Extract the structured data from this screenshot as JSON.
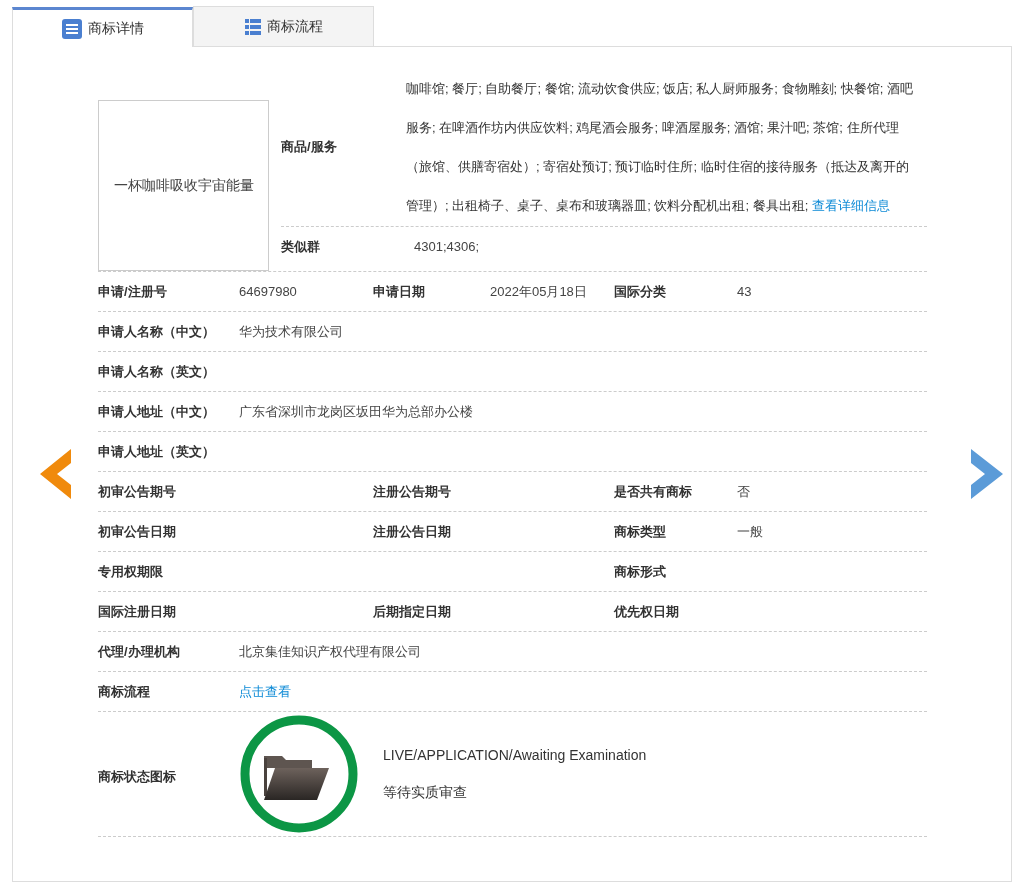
{
  "tabs": [
    {
      "label": "商标详情",
      "kind": "details",
      "selected": true
    },
    {
      "label": "商标流程",
      "kind": "flow",
      "selected": false
    }
  ],
  "trademark": {
    "image_text": "一杯咖啡吸收宇宙能量",
    "goods_label": "商品/服务",
    "goods_text": "咖啡馆; 餐厅; 自助餐厅; 餐馆; 流动饮食供应; 饭店; 私人厨师服务; 食物雕刻; 快餐馆; 酒吧服务; 在啤酒作坊内供应饮料; 鸡尾酒会服务; 啤酒屋服务; 酒馆; 果汁吧; 茶馆; 住所代理（旅馆、供膳寄宿处）; 寄宿处预订; 预订临时住所; 临时住宿的接待服务（抵达及离开的管理）; 出租椅子、桌子、桌布和玻璃器皿; 饮料分配机出租; 餐具出租;",
    "goods_link": "查看详细信息",
    "similar_label": "类似群",
    "similar_value": "4301;4306;"
  },
  "rows": [
    {
      "kind": "triple",
      "fields": [
        {
          "label": "申请/注册号",
          "value": "64697980"
        },
        {
          "label": "申请日期",
          "value": "2022年05月18日"
        },
        {
          "label": "国际分类",
          "value": "43"
        }
      ]
    },
    {
      "kind": "single",
      "fields": [
        {
          "label": "申请人名称（中文）",
          "value": "华为技术有限公司"
        }
      ]
    },
    {
      "kind": "single",
      "fields": [
        {
          "label": "申请人名称（英文）"
        }
      ]
    },
    {
      "kind": "single",
      "fields": [
        {
          "label": "申请人地址（中文）",
          "value": "广东省深圳市龙岗区坂田华为总部办公楼"
        }
      ]
    },
    {
      "kind": "single",
      "fields": [
        {
          "label": "申请人地址（英文）"
        }
      ]
    },
    {
      "kind": "triple",
      "fields": [
        {
          "label": "初审公告期号"
        },
        {
          "label": "注册公告期号"
        },
        {
          "label": "是否共有商标",
          "value": "否"
        }
      ]
    },
    {
      "kind": "triple",
      "fields": [
        {
          "label": "初审公告日期"
        },
        {
          "label": "注册公告日期"
        },
        {
          "label": "商标类型",
          "value": "一般"
        }
      ]
    },
    {
      "kind": "split",
      "fields": [
        {
          "label": "专用权期限"
        },
        {
          "label": "商标形式"
        }
      ]
    },
    {
      "kind": "triple",
      "fields": [
        {
          "label": "国际注册日期"
        },
        {
          "label": "后期指定日期"
        },
        {
          "label": "优先权日期"
        }
      ]
    },
    {
      "kind": "single",
      "fields": [
        {
          "label": "代理/办理机构",
          "value": "北京集佳知识产权代理有限公司"
        }
      ]
    },
    {
      "kind": "single",
      "fields": [
        {
          "label": "商标流程",
          "value": "点击查看",
          "link": true
        }
      ]
    }
  ],
  "status": {
    "label": "商标状态图标",
    "status_en": "LIVE/APPLICATION/Awaiting Examination",
    "status_zh": "等待实质审查"
  }
}
